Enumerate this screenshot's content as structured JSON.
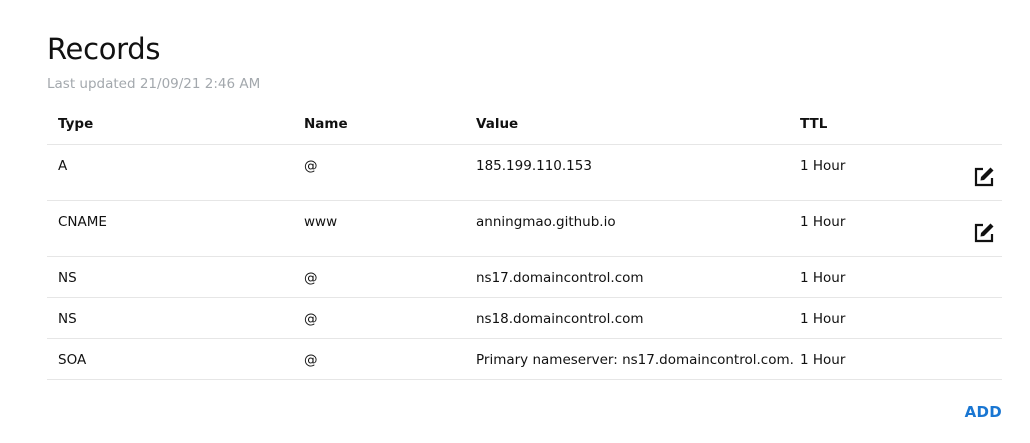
{
  "title": "Records",
  "last_updated": "Last updated 21/09/21 2:46 AM",
  "table": {
    "headers": [
      "Type",
      "Name",
      "Value",
      "TTL"
    ],
    "rows": [
      {
        "type": "A",
        "name": "@",
        "value": "185.199.110.153",
        "ttl": "1 Hour",
        "editable": true
      },
      {
        "type": "CNAME",
        "name": "www",
        "value": "anningmao.github.io",
        "ttl": "1 Hour",
        "editable": true
      },
      {
        "type": "NS",
        "name": "@",
        "value": "ns17.domaincontrol.com",
        "ttl": "1 Hour",
        "editable": false
      },
      {
        "type": "NS",
        "name": "@",
        "value": "ns18.domaincontrol.com",
        "ttl": "1 Hour",
        "editable": false
      },
      {
        "type": "SOA",
        "name": "@",
        "value": "Primary nameserver: ns17.domaincontrol.com.",
        "ttl": "1 Hour",
        "editable": false
      }
    ]
  },
  "add_label": "ADD",
  "colors": {
    "accent": "#1976d2",
    "muted_text": "#a3a8ad",
    "divider": "#e6e6e6"
  },
  "icons": {
    "edit": "edit-icon"
  }
}
